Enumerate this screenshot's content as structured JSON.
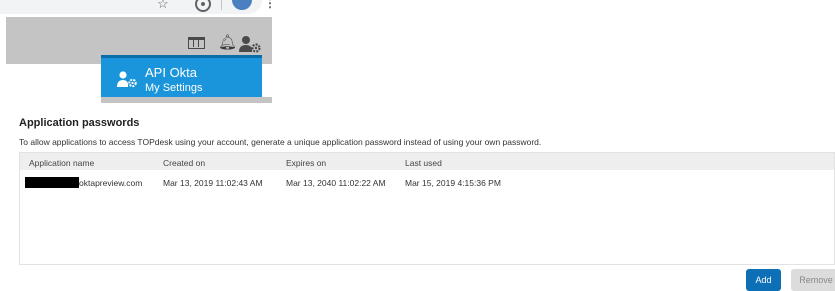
{
  "header": {
    "user_name": "API Okta",
    "settings_label": "My Settings"
  },
  "section": {
    "title": "Application passwords",
    "description": "To allow applications to access TOPdesk using your account, generate a unique application password instead of using your own password."
  },
  "table": {
    "columns": [
      "Application name",
      "Created on",
      "Expires on",
      "Last used"
    ],
    "rows": [
      {
        "application_name": "oktapreview.com",
        "created_on": "Mar 13, 2019 11:02:43 AM",
        "expires_on": "Mar 13, 2040 11:02:22 AM",
        "last_used": "Mar 15, 2019 4:15:36 PM"
      }
    ]
  },
  "actions": {
    "add_label": "Add",
    "remove_label": "Remove"
  },
  "colors": {
    "menu_blue": "#1a95db",
    "primary_button": "#0d6fb6",
    "header_gray": "#c4c4c4"
  }
}
